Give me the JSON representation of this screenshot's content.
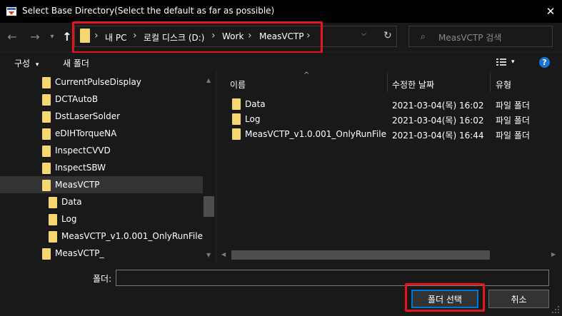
{
  "window": {
    "title": "Select Base Directory(Select the default as far as possible)",
    "close_glyph": "✕",
    "icon": "app-icon"
  },
  "nav": {
    "back_glyph": "←",
    "forward_glyph": "→",
    "recent_glyph": "▾",
    "up_glyph": "↑",
    "dropdown_glyph": "⌵",
    "refresh_glyph": "↻"
  },
  "address": {
    "crumbs": [
      "내 PC",
      "로컬 디스크 (D:)",
      "Work",
      "MeasVCTP"
    ],
    "separator": "›"
  },
  "search": {
    "placeholder": "MeasVCTP 검색",
    "icon_glyph": "⌕"
  },
  "toolbar": {
    "organize_label": "구성",
    "organize_caret": "▾",
    "new_folder_label": "새 폴더",
    "view_caret": "▾",
    "help_glyph": "?"
  },
  "tree": {
    "items": [
      {
        "label": "CurrentPulseDisplay"
      },
      {
        "label": "DCTAutoB"
      },
      {
        "label": "DstLaserSolder"
      },
      {
        "label": "eDIHTorqueNA"
      },
      {
        "label": "InspectCVVD"
      },
      {
        "label": "InspectSBW"
      },
      {
        "label": "MeasVCTP"
      },
      {
        "label": "Data"
      },
      {
        "label": "Log"
      },
      {
        "label": "MeasVCTP_v1.0.001_OnlyRunFile"
      },
      {
        "label": "MeasVCTP_"
      }
    ],
    "scroll_up_glyph": "▲",
    "scroll_down_glyph": "▼"
  },
  "list": {
    "columns": [
      "이름",
      "수정한 날짜",
      "유형"
    ],
    "sort_glyph": "^",
    "rows": [
      {
        "name": "Data",
        "date": "2021-03-04(목) 16:02",
        "type": "파일 폴더"
      },
      {
        "name": "Log",
        "date": "2021-03-04(목) 16:02",
        "type": "파일 폴더"
      },
      {
        "name": "MeasVCTP_v1.0.001_OnlyRunFile",
        "date": "2021-03-04(목) 16:44",
        "type": "파일 폴더"
      }
    ],
    "scroll_left_glyph": "◀",
    "scroll_right_glyph": "▶"
  },
  "footer": {
    "folder_label": "폴더:",
    "folder_value": "",
    "select_button": "폴더 선택",
    "cancel_button": "취소"
  },
  "colors": {
    "highlight": "#e3151d",
    "folder": "#f6d670",
    "accent": "#0078d7",
    "background": "#191919"
  }
}
